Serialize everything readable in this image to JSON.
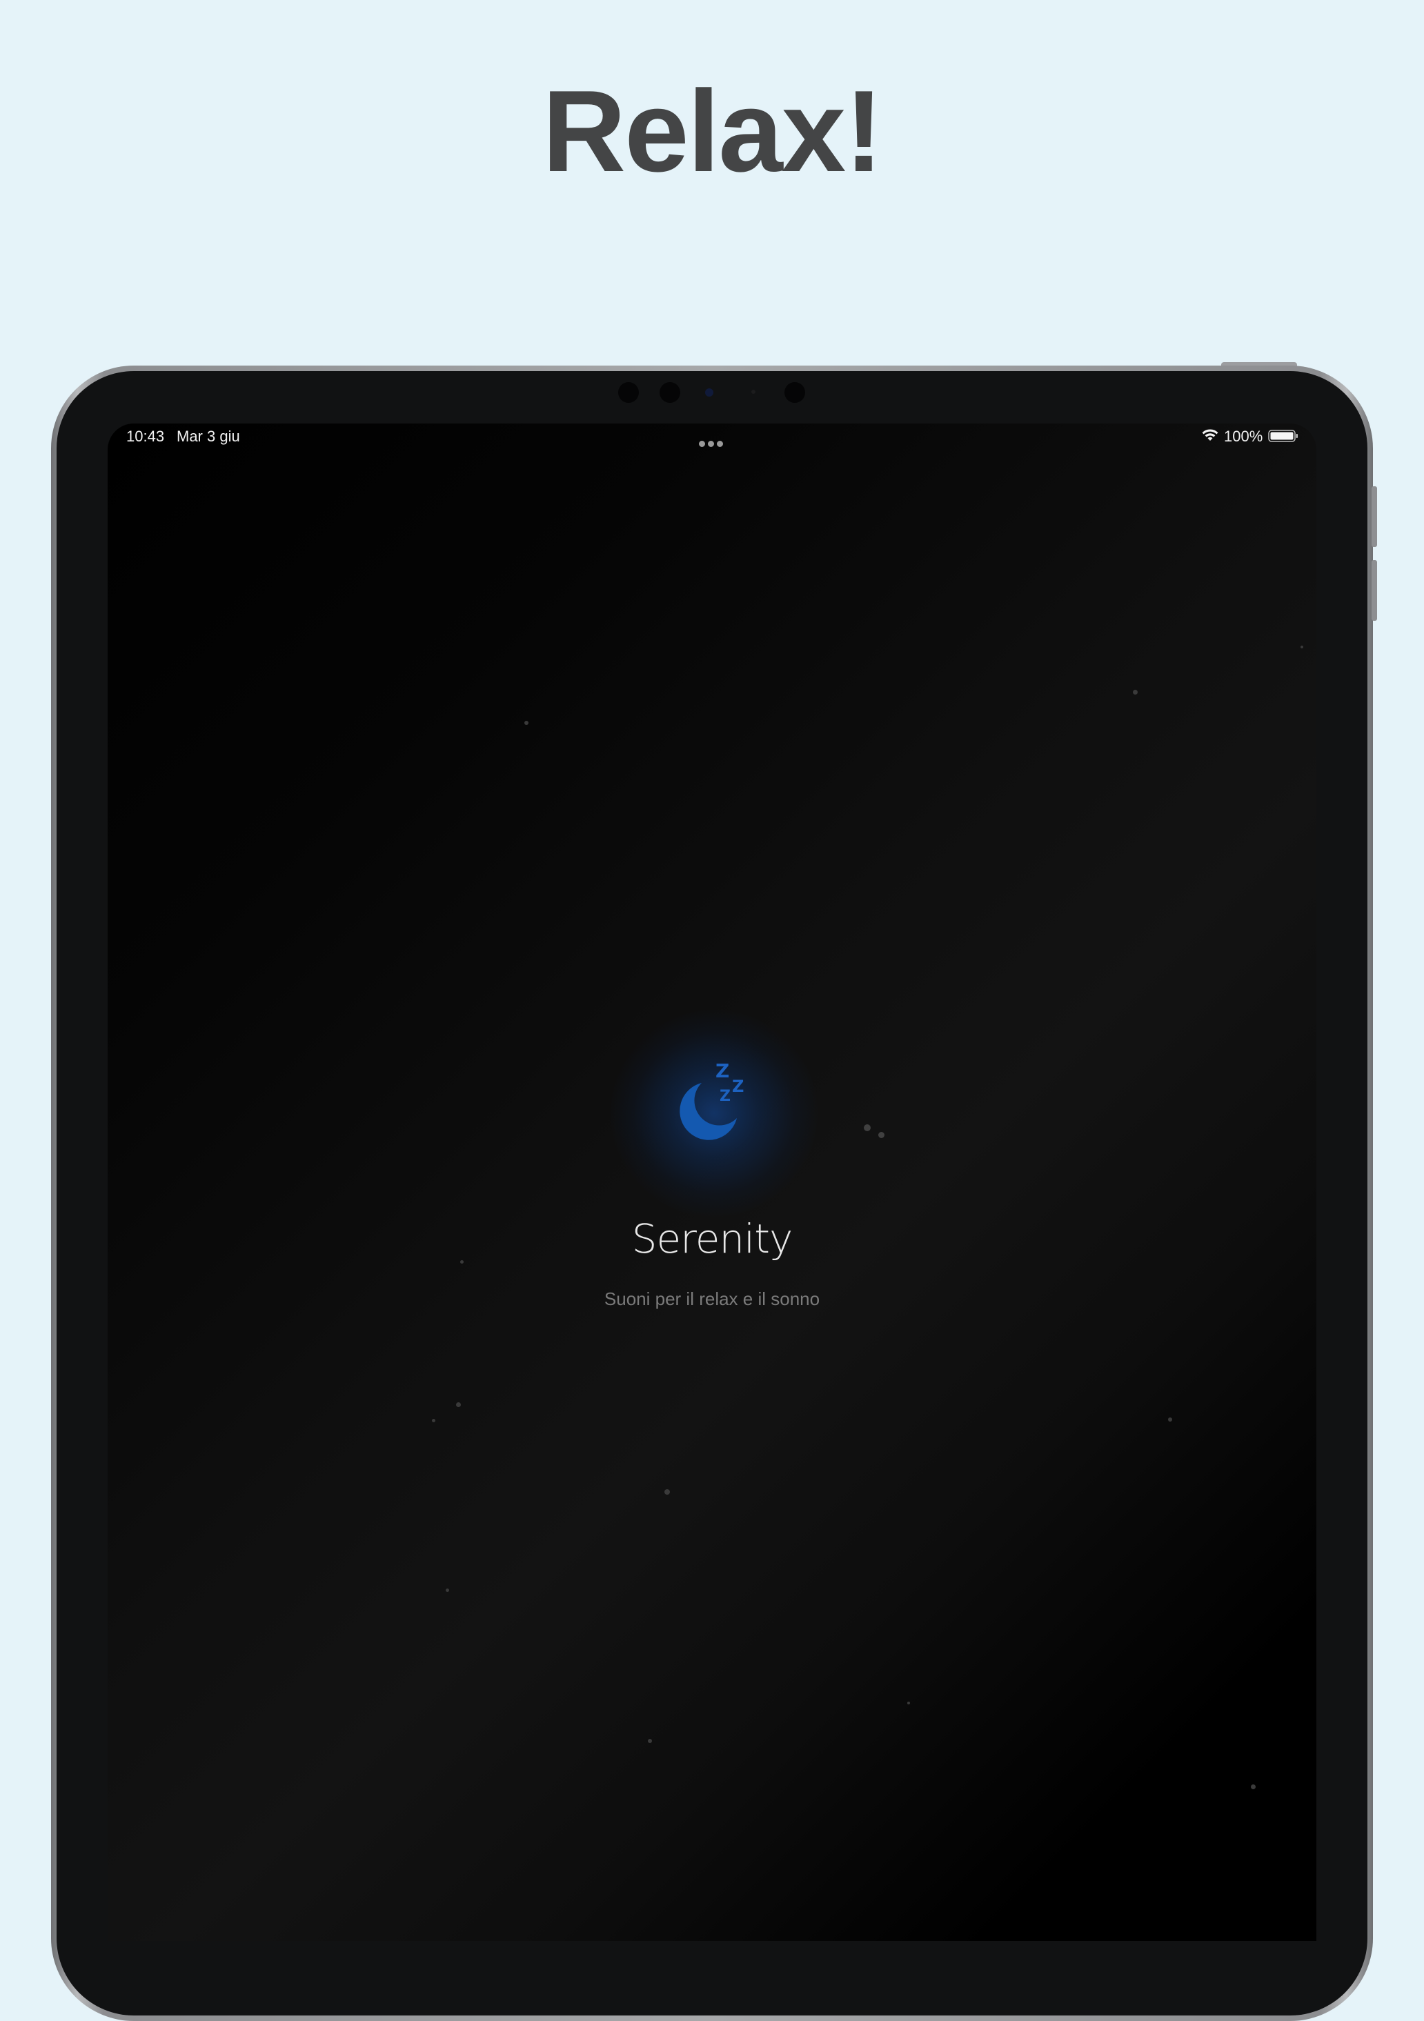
{
  "headline": "Relax!",
  "status_bar": {
    "time": "10:43",
    "date": "Mar 3 giu",
    "battery": "100%",
    "wifi_icon": "wifi-icon",
    "battery_icon": "battery-full-icon",
    "multitasking_icon": "ellipsis-icon"
  },
  "app": {
    "name": "Serenity",
    "tagline": "Suoni per il relax e il sonno",
    "icon": "moon-sleep-icon",
    "accent_color": "#1a5fb4"
  },
  "colors": {
    "page_background": "#e5f3f9",
    "headline": "#444546",
    "screen_background": "#0d0d0d"
  }
}
